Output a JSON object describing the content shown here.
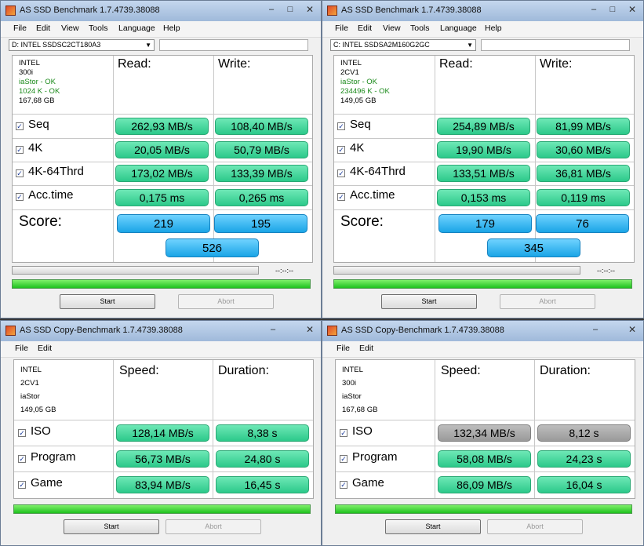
{
  "bench": [
    {
      "title": "AS SSD Benchmark 1.7.4739.38088",
      "drive": "D: INTEL SSDSC2CT180A3",
      "info": [
        "INTEL",
        "300i",
        "iaStor - OK",
        "1024 K - OK",
        "167,68 GB"
      ],
      "read_header": "Read:",
      "write_header": "Write:",
      "rows": [
        {
          "label": "Seq",
          "read": "262,93 MB/s",
          "write": "108,40 MB/s"
        },
        {
          "label": "4K",
          "read": "20,05 MB/s",
          "write": "50,79 MB/s"
        },
        {
          "label": "4K-64Thrd",
          "read": "173,02 MB/s",
          "write": "133,39 MB/s"
        },
        {
          "label": "Acc.time",
          "read": "0,175 ms",
          "write": "0,265 ms"
        }
      ],
      "score_label": "Score:",
      "score_read": "219",
      "score_write": "195",
      "score_total": "526",
      "time": "--:--:--",
      "start": "Start",
      "abort": "Abort"
    },
    {
      "title": "AS SSD Benchmark 1.7.4739.38088",
      "drive": "C: INTEL SSDSA2M160G2GC",
      "info": [
        "INTEL",
        "2CV1",
        "iaStor - OK",
        "234496 K - OK",
        "149,05 GB"
      ],
      "read_header": "Read:",
      "write_header": "Write:",
      "rows": [
        {
          "label": "Seq",
          "read": "254,89 MB/s",
          "write": "81,99 MB/s"
        },
        {
          "label": "4K",
          "read": "19,90 MB/s",
          "write": "30,60 MB/s"
        },
        {
          "label": "4K-64Thrd",
          "read": "133,51 MB/s",
          "write": "36,81 MB/s"
        },
        {
          "label": "Acc.time",
          "read": "0,153 ms",
          "write": "0,119 ms"
        }
      ],
      "score_label": "Score:",
      "score_read": "179",
      "score_write": "76",
      "score_total": "345",
      "time": "--:--:--",
      "start": "Start",
      "abort": "Abort"
    }
  ],
  "copy": [
    {
      "title": "AS SSD Copy-Benchmark 1.7.4739.38088",
      "info": [
        "INTEL",
        "2CV1",
        "iaStor",
        "149,05 GB"
      ],
      "speed_header": "Speed:",
      "duration_header": "Duration:",
      "rows": [
        {
          "label": "ISO",
          "speed": "128,14 MB/s",
          "duration": "8,38 s"
        },
        {
          "label": "Program",
          "speed": "56,73 MB/s",
          "duration": "24,80 s"
        },
        {
          "label": "Game",
          "speed": "83,94 MB/s",
          "duration": "16,45 s"
        }
      ],
      "start": "Start",
      "abort": "Abort"
    },
    {
      "title": "AS SSD Copy-Benchmark 1.7.4739.38088",
      "info": [
        "INTEL",
        "300i",
        "iaStor",
        "167,68 GB"
      ],
      "speed_header": "Speed:",
      "duration_header": "Duration:",
      "rows": [
        {
          "label": "ISO",
          "speed": "132,34 MB/s",
          "duration": "8,12 s"
        },
        {
          "label": "Program",
          "speed": "58,08 MB/s",
          "duration": "24,23 s"
        },
        {
          "label": "Game",
          "speed": "86,09 MB/s",
          "duration": "16,04 s"
        }
      ],
      "start": "Start",
      "abort": "Abort"
    }
  ],
  "menu_bench": [
    "File",
    "Edit",
    "View",
    "Tools",
    "Language",
    "Help"
  ],
  "menu_copy": [
    "File",
    "Edit"
  ],
  "window_controls": {
    "min": "–",
    "max": "□",
    "close": "✕"
  },
  "colors": {
    "value_green": "#2cc98a",
    "score_blue": "#1aa5e6",
    "progress_green": "#1fc21f",
    "finished_gray": "#9a9a9a"
  }
}
